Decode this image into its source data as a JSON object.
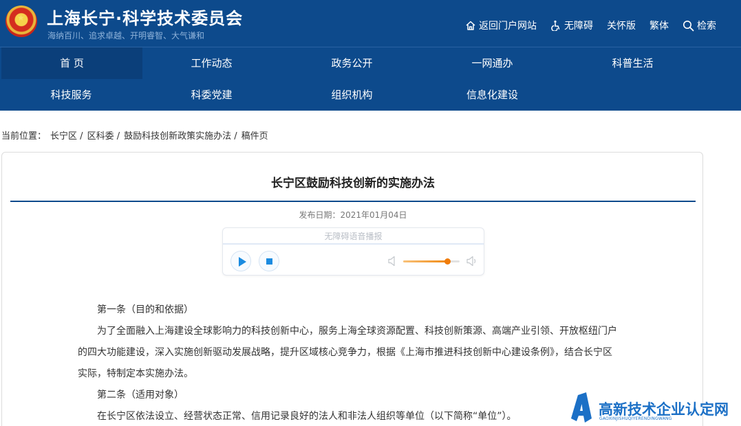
{
  "header": {
    "title": "上海长宁·科学技术委员会",
    "slogan": "海纳百川、追求卓越、开明睿智、大气谦和",
    "links": [
      {
        "label": "返回门户网站",
        "icon": "home-icon"
      },
      {
        "label": "无障碍",
        "icon": "accessibility-icon"
      },
      {
        "label": "关怀版"
      },
      {
        "label": "繁体"
      },
      {
        "label": "检索",
        "icon": "search-icon"
      }
    ]
  },
  "nav": {
    "items": [
      "首 页",
      "工作动态",
      "政务公开",
      "一网通办",
      "科普生活",
      "科技服务",
      "科委党建",
      "组织机构",
      "信息化建设"
    ],
    "active": "首 页"
  },
  "breadcrumb": {
    "prefix": "当前位置：",
    "items": [
      "长宁区",
      "区科委",
      "鼓励科技创新政策实施办法",
      "稿件页"
    ],
    "separator": "/"
  },
  "article": {
    "title": "长宁区鼓励科技创新的实施办法",
    "publish_date": "发布日期：2021年01月04日",
    "paragraphs": [
      "第一条（目的和依据）",
      "为了全面融入上海建设全球影响力的科技创新中心，服务上海全球资源配置、科技创新策源、高端产业引领、开放枢纽门户的四大功能建设，深入实施创新驱动发展战略，提升区域核心竞争力，根据《上海市推进科技创新中心建设条例》，结合长宁区实际，特制定本实施办法。",
      "第二条（适用对象）",
      "在长宁区依法设立、经营状态正常、信用记录良好的法人和非法人组织等单位（以下简称“单位”）。"
    ]
  },
  "player": {
    "label": "无障碍语音播报",
    "volume": 0.78,
    "accent_color": "#1a8be0",
    "volume_color": "#f07c0a"
  },
  "watermark": {
    "title": "高新技术企业认定网",
    "subtitle": "GAOXINJISHUQIYERENDINGWANG"
  },
  "colors": {
    "brand": "#0d4a8c",
    "nav_active": "#0b3f7a"
  }
}
